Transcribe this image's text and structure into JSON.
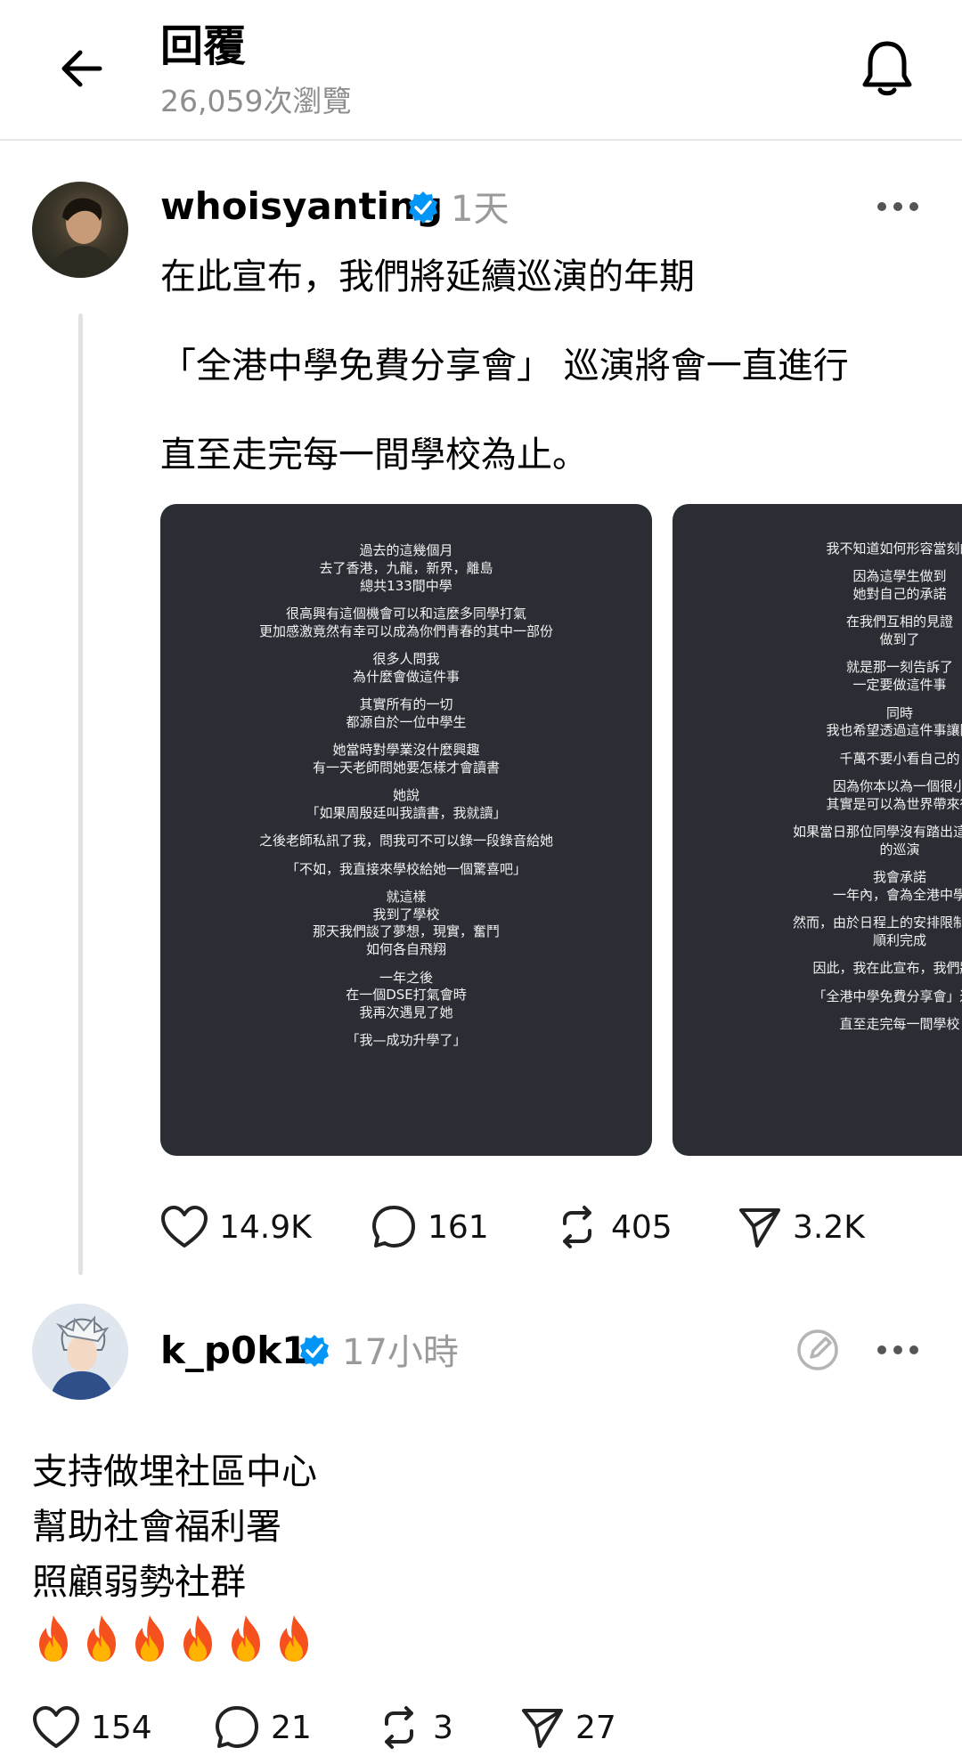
{
  "header": {
    "title": "回覆",
    "views": "26,059次瀏覽"
  },
  "post": {
    "username": "whoisyanting",
    "time": "1天",
    "text": [
      "在此宣布，我們將延續巡演的年期",
      "「全港中學免費分享會」 巡演將會一直進行",
      "直至走完每一間學校為止。"
    ],
    "image1_lines": [
      "過去的這幾個月",
      "去了香港，九龍，新界，離島",
      "總共133間中學",
      "",
      "很高興有這個機會可以和這麼多同學打氣",
      "更加感激竟然有幸可以成為你們青春的其中一部份",
      "",
      "很多人問我",
      "為什麼會做這件事",
      "",
      "其實所有的一切",
      "都源自於一位中學生",
      "",
      "她當時對學業沒什麼興趣",
      "有一天老師問她要怎樣才會讀書",
      "",
      "她說",
      "「如果周殷廷叫我讀書，我就讀」",
      "",
      "之後老師私訊了我，問我可不可以錄一段錄音給她",
      "",
      "「不如，我直接來學校給她一個驚喜吧」",
      "",
      "就這樣",
      "我到了學校",
      "那天我們談了夢想，現實，奮鬥",
      "如何各自飛翔",
      "",
      "一年之後",
      "在一個DSE打氣會時",
      "我再次遇見了她",
      "",
      "「我—成功升學了」"
    ],
    "image2_lines": [
      "我不知道如何形容當刻的",
      "",
      "因為這學生做到",
      "她對自己的承諾",
      "",
      "在我們互相的見證",
      "做到了",
      "",
      "就是那一刻告訴了",
      "一定要做這件事",
      "",
      "同時",
      "我也希望透過這件事讓同",
      "",
      "千萬不要小看自己的",
      "",
      "因為你本以為一個很小",
      "其實是可以為世界帶來很",
      "",
      "如果當日那位同學沒有踏出這一步，",
      "的巡演",
      "",
      "我會承諾",
      "一年內，會為全港中學",
      "",
      "然而，由於日程上的安排限制，並非",
      "順利完成",
      "",
      "因此，我在此宣布，我們將延",
      "",
      "「全港中學免費分享會」巡演",
      "",
      "直至走完每一間學校"
    ],
    "likes": "14.9K",
    "comments": "161",
    "reposts": "405",
    "shares": "3.2K"
  },
  "reply": {
    "username": "k_p0k1",
    "time": "17小時",
    "text": [
      "支持做埋社區中心",
      "幫助社會福利署",
      "照顧弱勢社群"
    ],
    "emoji_count": 6,
    "likes": "154",
    "comments": "21",
    "reposts": "3",
    "shares": "27"
  },
  "colors": {
    "verified": "#0095f6",
    "muted": "#9a9a9a",
    "card_bg": "#2a2d33"
  }
}
